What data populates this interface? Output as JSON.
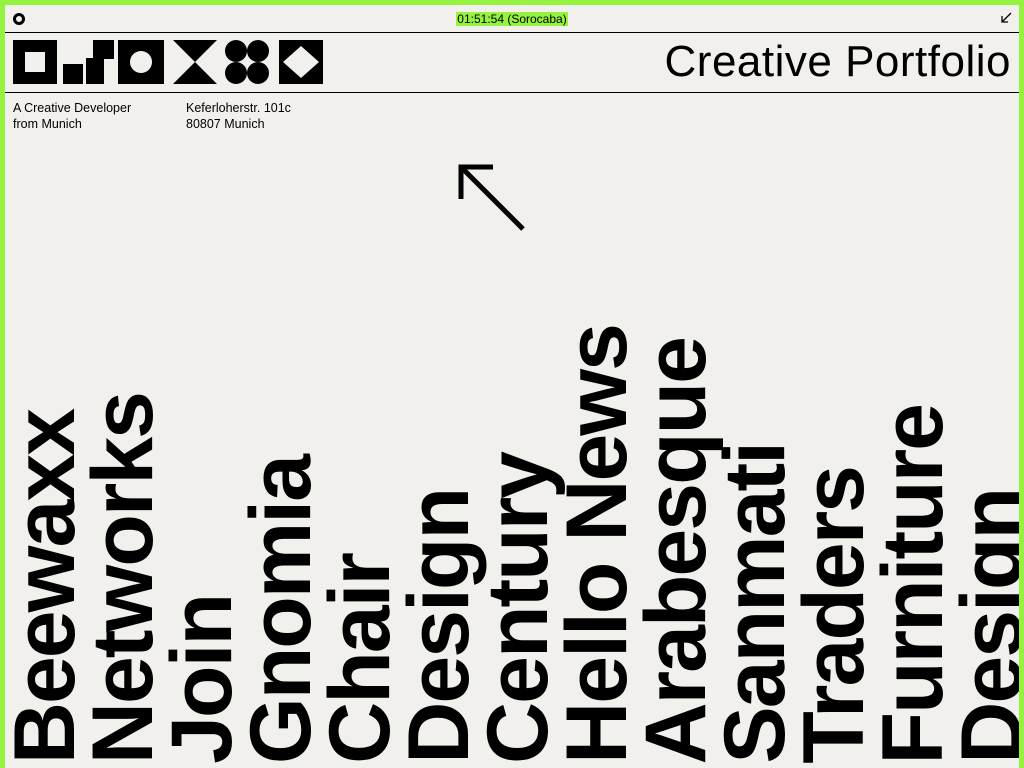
{
  "topbar": {
    "clock": "01:51:54 (Sorocaba)",
    "highlight_color": "#95f23e"
  },
  "header": {
    "title": "Creative Portfolio"
  },
  "info": {
    "tagline_line1": "A Creative Developer",
    "tagline_line2": "from Munich",
    "address_line1": "Keferloherstr. 101c",
    "address_line2": "80807 Munich"
  },
  "icons": {
    "menu": "dot-icon",
    "corner": "arrow-down-left-icon",
    "pointer": "arrow-up-left-icon",
    "logo": "geometric-logo-icon"
  },
  "projects": [
    "Beewaxx",
    "Networks",
    "Join",
    "Gnomia",
    "Chair",
    "Design",
    "Century",
    "Hello News",
    "Arabesque",
    "Sanmati",
    "Traders",
    "Furniture",
    "Design"
  ]
}
